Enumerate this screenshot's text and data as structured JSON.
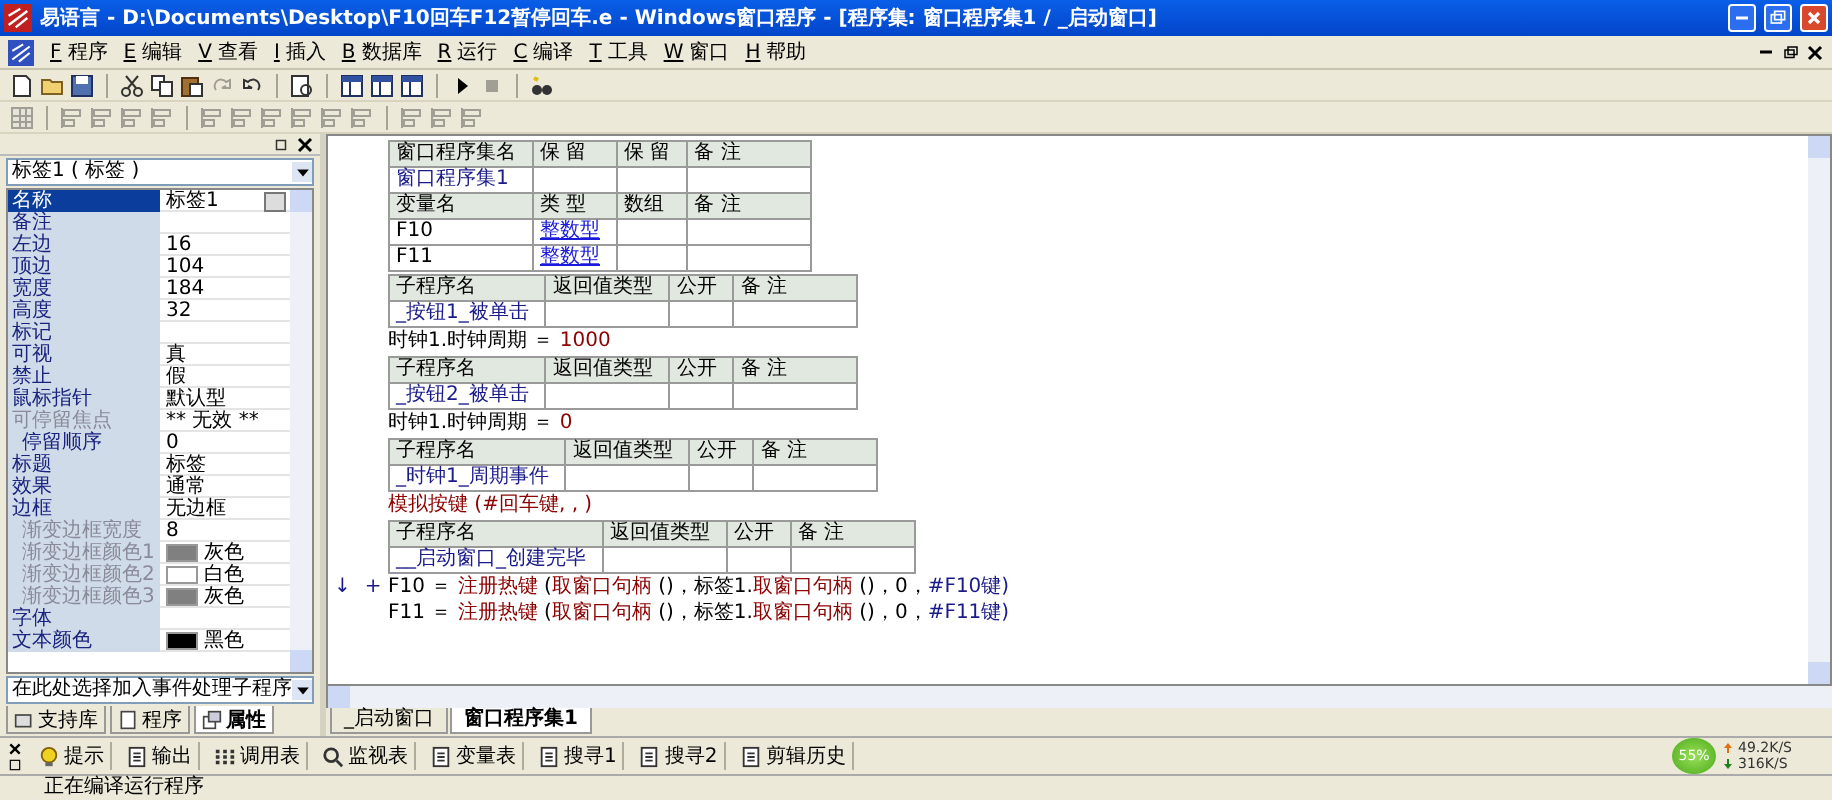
{
  "window": {
    "title": "易语言 - D:\\Documents\\Desktop\\F10回车F12暂停回车.e - Windows窗口程序 - [程序集: 窗口程序集1 / _启动窗口]"
  },
  "menu": [
    {
      "key": "F",
      "label": "程序"
    },
    {
      "key": "E",
      "label": "编辑"
    },
    {
      "key": "V",
      "label": "查看"
    },
    {
      "key": "I",
      "label": "插入"
    },
    {
      "key": "B",
      "label": "数据库"
    },
    {
      "key": "R",
      "label": "运行"
    },
    {
      "key": "C",
      "label": "编译"
    },
    {
      "key": "T",
      "label": "工具"
    },
    {
      "key": "W",
      "label": "窗口"
    },
    {
      "key": "H",
      "label": "帮助"
    }
  ],
  "toolbar_main": [
    {
      "kind": "new",
      "disabled": false
    },
    {
      "kind": "open",
      "disabled": false
    },
    {
      "kind": "save",
      "disabled": false
    },
    {
      "kind": "sep"
    },
    {
      "kind": "cut",
      "disabled": false
    },
    {
      "kind": "copy",
      "disabled": false
    },
    {
      "kind": "paste",
      "disabled": false
    },
    {
      "kind": "redo",
      "disabled": true
    },
    {
      "kind": "undo",
      "disabled": false
    },
    {
      "kind": "sep"
    },
    {
      "kind": "find",
      "disabled": false
    },
    {
      "kind": "sep"
    },
    {
      "kind": "layout",
      "disabled": false
    },
    {
      "kind": "layout",
      "disabled": false
    },
    {
      "kind": "layout",
      "disabled": false
    },
    {
      "kind": "sep"
    },
    {
      "kind": "run",
      "disabled": false
    },
    {
      "kind": "stop",
      "disabled": true
    },
    {
      "kind": "sep"
    },
    {
      "kind": "binoculars",
      "disabled": false
    }
  ],
  "toolbar_align": [
    {
      "kind": "grid",
      "disabled": true
    },
    {
      "kind": "sep"
    },
    {
      "kind": "align",
      "disabled": true
    },
    {
      "kind": "align",
      "disabled": true
    },
    {
      "kind": "align",
      "disabled": true
    },
    {
      "kind": "align",
      "disabled": true
    },
    {
      "kind": "sep"
    },
    {
      "kind": "align",
      "disabled": true
    },
    {
      "kind": "align",
      "disabled": true
    },
    {
      "kind": "align",
      "disabled": true
    },
    {
      "kind": "align",
      "disabled": true
    },
    {
      "kind": "align",
      "disabled": true
    },
    {
      "kind": "align",
      "disabled": true
    },
    {
      "kind": "sep"
    },
    {
      "kind": "align",
      "disabled": true
    },
    {
      "kind": "align",
      "disabled": true
    },
    {
      "kind": "align",
      "disabled": true
    }
  ],
  "properties": {
    "object": "标签1 ( 标签 )",
    "rows": [
      {
        "name": "名称",
        "value": "标签1",
        "selected": true,
        "disabled": false
      },
      {
        "name": "备注",
        "selected": false,
        "disabled": false
      },
      {
        "name": "左边",
        "value": "16",
        "selected": false,
        "disabled": false
      },
      {
        "name": "顶边",
        "value": "104",
        "selected": false,
        "disabled": false
      },
      {
        "name": "宽度",
        "value": "184",
        "selected": false,
        "disabled": false
      },
      {
        "name": "高度",
        "value": "32",
        "selected": false,
        "disabled": false
      },
      {
        "name": "标记",
        "selected": false,
        "disabled": false
      },
      {
        "name": "可视",
        "value": "真",
        "selected": false,
        "disabled": false
      },
      {
        "name": "禁止",
        "value": "假",
        "selected": false,
        "disabled": false
      },
      {
        "name": "鼠标指针",
        "value": "默认型",
        "selected": false,
        "disabled": false
      },
      {
        "name": "可停留焦点",
        "value": "** 无效 **",
        "selected": false,
        "disabled": true,
        "children": [
          {
            "name": "停留顺序",
            "value": "0",
            "selected": false,
            "disabled": false
          }
        ]
      },
      {
        "name": "标题",
        "value": "标签",
        "selected": false,
        "disabled": false
      },
      {
        "name": "效果",
        "value": "通常",
        "selected": false,
        "disabled": false
      },
      {
        "name": "边框",
        "value": "无边框",
        "selected": false,
        "disabled": false,
        "children": [
          {
            "name": "渐变边框宽度",
            "value": "8",
            "selected": false,
            "disabled": true
          },
          {
            "name": "渐变边框颜色1",
            "value": "灰色",
            "color": "#808080",
            "selected": false,
            "disabled": true
          },
          {
            "name": "渐变边框颜色2",
            "value": "白色",
            "color": "#ffffff",
            "selected": false,
            "disabled": true
          },
          {
            "name": "渐变边框颜色3",
            "value": "灰色",
            "color": "#808080",
            "selected": false,
            "disabled": true
          }
        ]
      },
      {
        "name": "字体",
        "selected": false,
        "disabled": false
      },
      {
        "name": "文本颜色",
        "value": "黑色",
        "color": "#000000",
        "selected": false,
        "disabled": false
      }
    ],
    "event_picker": "在此处选择加入事件处理子程序"
  },
  "left_tabs": [
    {
      "label": "支持库",
      "selected": false
    },
    {
      "label": "程序",
      "selected": false
    },
    {
      "label": "属性",
      "selected": true
    }
  ],
  "code": {
    "blocks": [
      {
        "kind": "table",
        "rows": [
          {
            "kind": "header",
            "cells": [
              {
                "text": "窗口程序集名"
              },
              {
                "text": "保 留"
              },
              {
                "text": "保 留"
              },
              {
                "text": "备 注"
              }
            ]
          },
          {
            "kind": "data",
            "cells": [
              {
                "text": "窗口程序集1",
                "kind": "name"
              }
            ]
          },
          {
            "kind": "header",
            "cells": [
              {
                "text": "变量名"
              },
              {
                "text": "类 型"
              },
              {
                "text": "数组"
              },
              {
                "text": "备 注"
              }
            ]
          },
          {
            "kind": "data",
            "cells": [
              {
                "text": "F10",
                "kind": "plain"
              },
              {
                "text": "整数型",
                "kind": "type"
              }
            ]
          },
          {
            "kind": "data",
            "cells": [
              {
                "text": "F11",
                "kind": "plain"
              },
              {
                "text": "整数型",
                "kind": "type"
              }
            ]
          }
        ]
      },
      {
        "kind": "table",
        "rows": [
          {
            "kind": "header",
            "cells": [
              {
                "text": "子程序名"
              },
              {
                "text": "返回值类型"
              },
              {
                "text": "公开"
              },
              {
                "text": "备 注"
              }
            ]
          },
          {
            "kind": "data",
            "cells": [
              {
                "text": "_按钮1_被单击",
                "kind": "name"
              }
            ]
          }
        ]
      },
      {
        "kind": "line",
        "segments": [
          {
            "text": "时钟1.时钟周期 ＝ ",
            "kind": "plain"
          },
          {
            "text": "1000",
            "kind": "number"
          }
        ]
      },
      {
        "kind": "table",
        "rows": [
          {
            "kind": "header",
            "cells": [
              {
                "text": "子程序名"
              },
              {
                "text": "返回值类型"
              },
              {
                "text": "公开"
              },
              {
                "text": "备 注"
              }
            ]
          },
          {
            "kind": "data",
            "cells": [
              {
                "text": "_按钮2_被单击",
                "kind": "name"
              }
            ]
          }
        ]
      },
      {
        "kind": "line",
        "segments": [
          {
            "text": "时钟1.时钟周期 ＝ ",
            "kind": "plain"
          },
          {
            "text": "0",
            "kind": "number"
          }
        ]
      },
      {
        "kind": "table",
        "rows": [
          {
            "kind": "header",
            "cells": [
              {
                "text": "子程序名"
              },
              {
                "text": "返回值类型"
              },
              {
                "text": "公开"
              },
              {
                "text": "备 注"
              }
            ]
          },
          {
            "kind": "data",
            "cells": [
              {
                "text": "_时钟1_周期事件",
                "kind": "name"
              }
            ]
          }
        ]
      },
      {
        "kind": "line",
        "segments": [
          {
            "text": "模拟按键",
            "kind": "command"
          },
          {
            "text": " (#回车键, , )",
            "kind": "command"
          }
        ]
      },
      {
        "kind": "table",
        "rows": [
          {
            "kind": "header",
            "cells": [
              {
                "text": "子程序名"
              },
              {
                "text": "返回值类型"
              },
              {
                "text": "公开"
              },
              {
                "text": "备 注"
              }
            ]
          },
          {
            "kind": "data",
            "cells": [
              {
                "text": "__启动窗口_创建完毕",
                "kind": "name"
              }
            ]
          }
        ]
      },
      {
        "kind": "line",
        "gutter": [
          "↓",
          "+"
        ],
        "segments": [
          {
            "text": "F10 ＝ ",
            "kind": "plain"
          },
          {
            "text": "注册热键",
            "kind": "command"
          },
          {
            "text": " (",
            "kind": "plain"
          },
          {
            "text": "取窗口句柄",
            "kind": "command"
          },
          {
            "text": " ()，标签1.",
            "kind": "plain"
          },
          {
            "text": "取窗口句柄",
            "kind": "command"
          },
          {
            "text": " ()，0，",
            "kind": "plain"
          },
          {
            "text": "#F10键)",
            "kind": "constant"
          }
        ]
      },
      {
        "kind": "line",
        "segments": [
          {
            "text": "F11 ＝ ",
            "kind": "plain"
          },
          {
            "text": "注册热键",
            "kind": "command"
          },
          {
            "text": " (",
            "kind": "plain"
          },
          {
            "text": "取窗口句柄",
            "kind": "command"
          },
          {
            "text": " ()，标签1.",
            "kind": "plain"
          },
          {
            "text": "取窗口句柄",
            "kind": "command"
          },
          {
            "text": " ()，0，",
            "kind": "plain"
          },
          {
            "text": "#F11键)",
            "kind": "constant"
          }
        ]
      }
    ],
    "tabs": [
      {
        "label": "_启动窗口",
        "selected": false
      },
      {
        "label": "窗口程序集1",
        "selected": true
      }
    ]
  },
  "output_tabs": [
    {
      "kind": "bulb",
      "label": "提示"
    },
    {
      "kind": "doc",
      "label": "输出"
    },
    {
      "kind": "list",
      "label": "调用表"
    },
    {
      "kind": "search",
      "label": "监视表"
    },
    {
      "kind": "doc",
      "label": "变量表"
    },
    {
      "kind": "doc",
      "label": "搜寻1"
    },
    {
      "kind": "doc",
      "label": "搜寻2"
    },
    {
      "kind": "doc",
      "label": "剪辑历史"
    }
  ],
  "net_meter": {
    "percent": "55%",
    "up": "49.2K/S",
    "down": "316K/S"
  },
  "status": {
    "text": "正在编译运行程序"
  }
}
